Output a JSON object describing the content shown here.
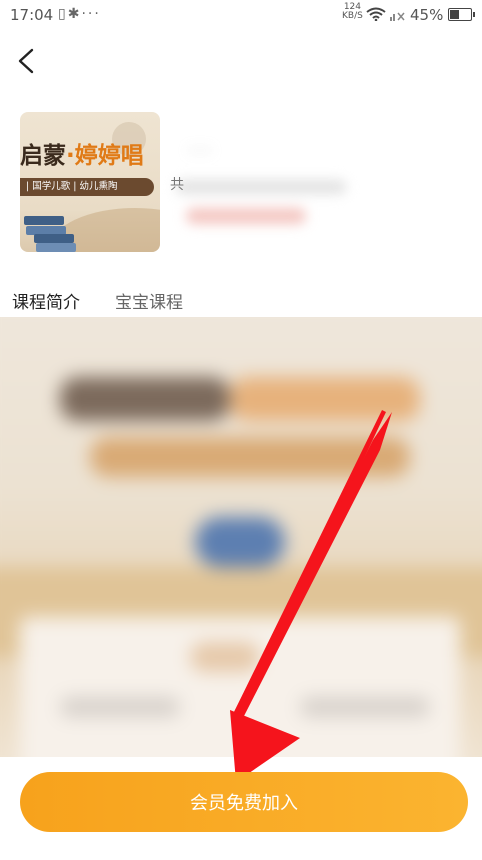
{
  "status_bar": {
    "time": "17:04",
    "net_speed_value": "124",
    "net_speed_unit": "KB/S",
    "battery_percent": "45%",
    "battery_level": 0.45,
    "icons": [
      "vibrate-icon",
      "bluetooth-icon",
      "more-dots-icon",
      "wifi-icon",
      "signal-icon",
      "battery-icon"
    ]
  },
  "header": {
    "back_icon": "chevron-left-icon"
  },
  "course": {
    "thumbnail_title_dark": "启蒙",
    "thumbnail_title_orange": "·婷婷唱",
    "thumbnail_tags": "| 国学儿歌 | 幼儿熏陶",
    "title_blurred": "…",
    "meta_partial": "共"
  },
  "tabs": [
    {
      "label": "课程简介",
      "active": true
    },
    {
      "label": "宝宝课程",
      "active": false
    }
  ],
  "join_button": {
    "label": "会员免费加入",
    "color": "#f7a21c"
  },
  "annotation": {
    "arrow_color": "#f5141c"
  }
}
